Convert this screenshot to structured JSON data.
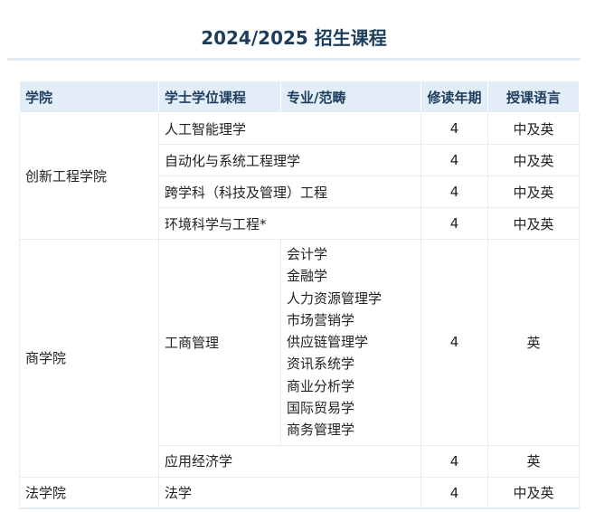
{
  "title": "2024/2025 招生课程",
  "columns": {
    "school": "学院",
    "program": "学士学位课程",
    "major": "专业/范畴",
    "years": "修读年期",
    "language": "授课语言"
  },
  "schools": [
    {
      "name": "创新工程学院",
      "programs": [
        {
          "name": "人工智能理学",
          "years": "4",
          "language": "中及英"
        },
        {
          "name": "自动化与系统工程理学",
          "years": "4",
          "language": "中及英"
        },
        {
          "name": "跨学科（科技及管理）工程",
          "years": "4",
          "language": "中及英"
        },
        {
          "name": "环境科学与工程*",
          "years": "4",
          "language": "中及英"
        }
      ]
    },
    {
      "name": "商学院",
      "programs": [
        {
          "name": "工商管理",
          "majors": [
            "会计学",
            "金融学",
            "人力资源管理学",
            "市场营销学",
            "供应链管理学",
            "资讯系统学",
            "商业分析学",
            "国际贸易学",
            "商务管理学"
          ],
          "years": "4",
          "language": "英"
        },
        {
          "name": "应用经济学",
          "years": "4",
          "language": "英"
        }
      ]
    },
    {
      "name": "法学院",
      "programs": [
        {
          "name": "法学",
          "years": "4",
          "language": "中及英"
        }
      ]
    }
  ]
}
